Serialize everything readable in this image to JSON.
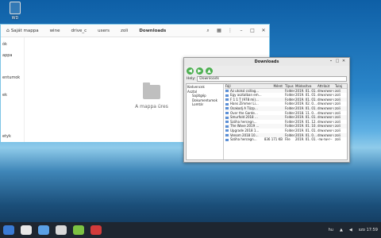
{
  "desktop": {
    "icon_label": "WD"
  },
  "file_manager": {
    "breadcrumbs": [
      "Saját mappa",
      "wine",
      "drive_c",
      "users",
      "zoli",
      "Downloads"
    ],
    "side_items": [
      "ók",
      "appa",
      "entumok",
      "ek",
      "etyk"
    ],
    "empty_text": "A mappa üres"
  },
  "downloads_window": {
    "title": "Downloads",
    "address_label": "Hely:",
    "address_value": "Downloads",
    "tree": [
      "Kedvencek",
      "Asztal",
      "Sajátgép",
      "Dokumentumok",
      "Lomtár"
    ],
    "columns": [
      "Fájl",
      "Méret",
      "Típus",
      "Módosítva",
      "Attribút",
      "Tulaj"
    ],
    "rows": [
      [
        "Az utolsó csillag…",
        "",
        "Folder",
        "2019. 01. 01. …",
        "drwxrwxr-x",
        "zoli"
      ],
      [
        "Egy asztalban em…",
        "",
        "Folder",
        "2019. 01. 01. …",
        "drwxrwxr-x",
        "zoli"
      ],
      [
        "F 1 1 T (978 mi)…",
        "",
        "Folder",
        "2019. 01. 01. …",
        "drwxrwxr-x",
        "zoli"
      ],
      [
        "Hans Zimmer Li…",
        "",
        "Folder",
        "2019. 02. 0…",
        "drwxrwxr-x",
        "zoli"
      ],
      [
        "Osakodj A Tűzp…",
        "",
        "Folder",
        "2019. 01. 01. …",
        "drwxrwxr-x",
        "zoli"
      ],
      [
        "Over the Garde…",
        "",
        "Folder",
        "2018. 11. 0…",
        "drwxrwxr-x",
        "zoli"
      ],
      [
        "Smurfold 2018 …",
        "",
        "Folder",
        "2019. 01. 01. …",
        "drwxrwxr-x",
        "zoli"
      ],
      [
        "Szóha hercegn…",
        "",
        "Folder",
        "2019. 01. 12. …",
        "drwxrwxr-x",
        "zoli"
      ],
      [
        "The Wave 2019 …",
        "",
        "Folder",
        "2019. 01. 10. …",
        "drwxrwxr-x",
        "zoli"
      ],
      [
        "Upgrade 2018 1…",
        "",
        "Folder",
        "2019. 01. 01. …",
        "drwxrwxr-x",
        "zoli"
      ],
      [
        "Venom 2018 10…",
        "",
        "Folder",
        "2019. 01. 0…",
        "drwxrwxr-x",
        "zoli"
      ],
      [
        "Szóha hercegn…",
        "836 171 KB",
        "File",
        "2019. 01. 01. …",
        "-rw-rw-r--",
        "zoli"
      ]
    ]
  },
  "taskbar": {
    "tray_lang": "hu",
    "clock": "szo 17:59"
  }
}
